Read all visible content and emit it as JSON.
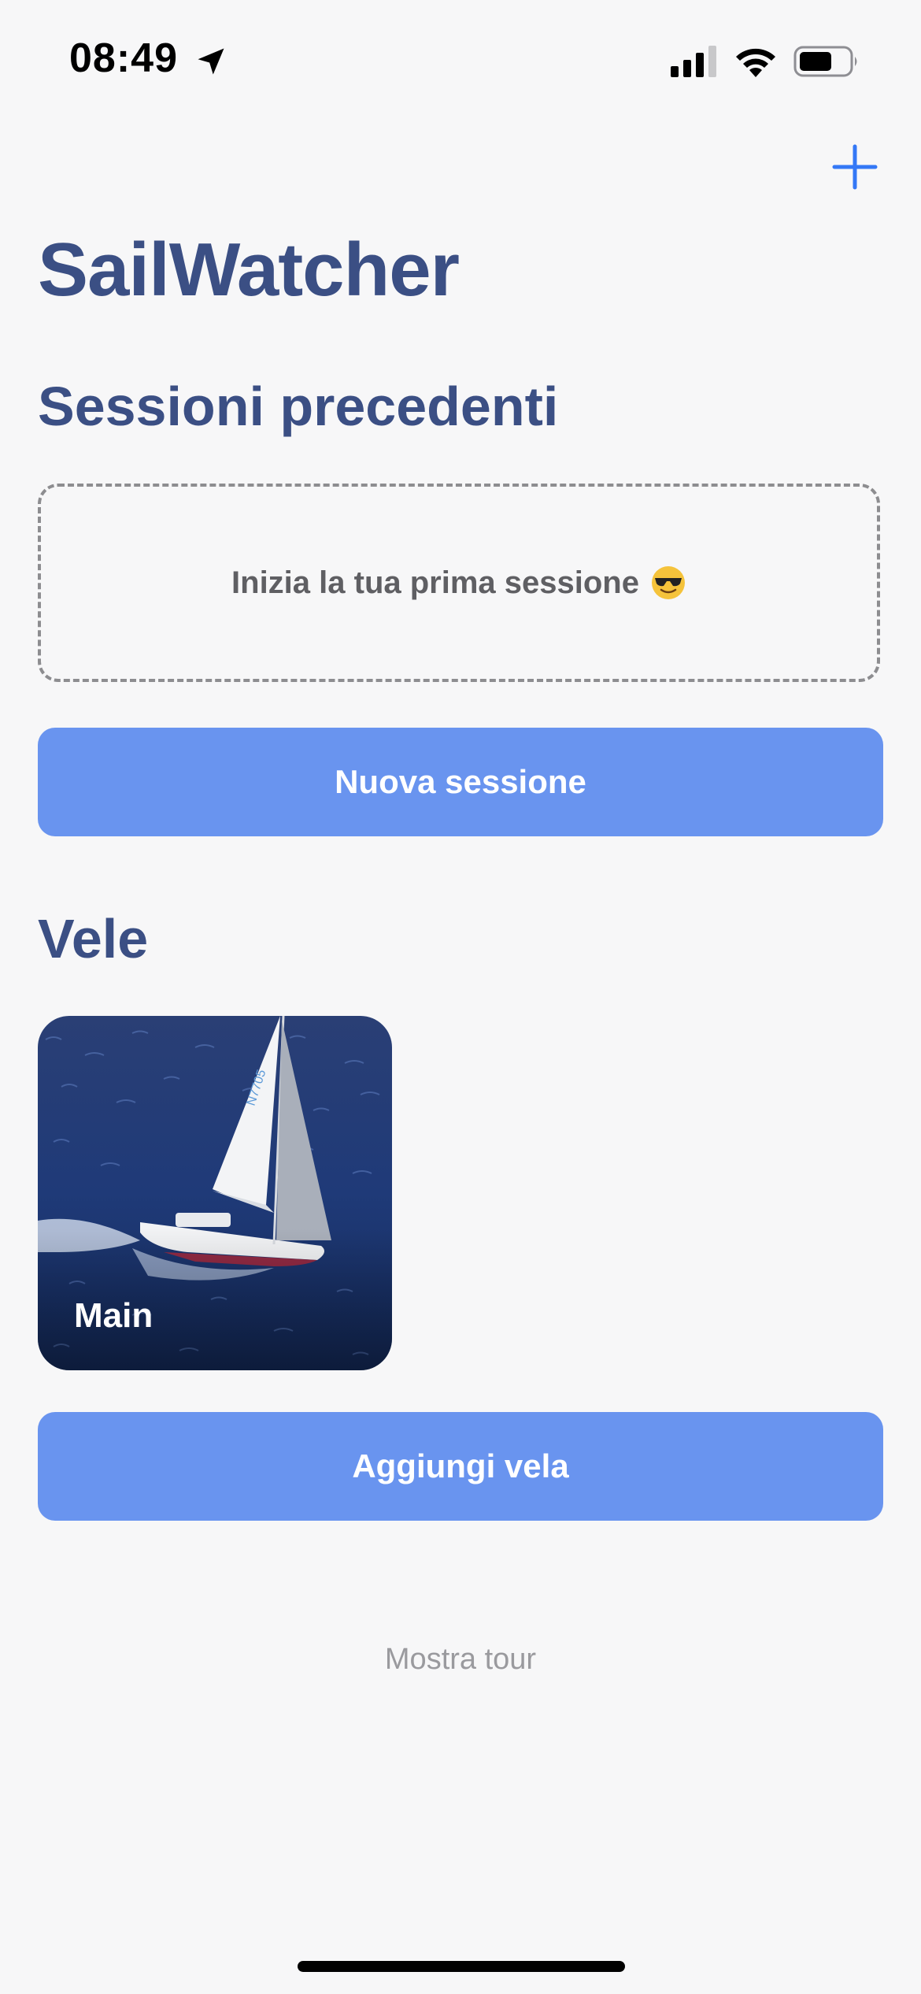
{
  "status_bar": {
    "time": "08:49",
    "icons": [
      "location-arrow-icon",
      "cellular-signal-icon",
      "wifi-icon",
      "battery-icon"
    ]
  },
  "nav": {
    "add_icon": "plus-icon"
  },
  "app_title": "SailWatcher",
  "sessions": {
    "title": "Sessioni precedenti",
    "empty_text": "Inizia la tua prima sessione",
    "empty_emoji": "sunglasses-face-icon",
    "new_session_label": "Nuova sessione"
  },
  "sails": {
    "title": "Vele",
    "items": [
      {
        "label": "Main",
        "image": "sailboat-photo"
      }
    ],
    "add_sail_label": "Aggiungi vela"
  },
  "footer": {
    "tour_label": "Mostra tour"
  },
  "colors": {
    "background": "#f7f7f8",
    "title": "#3b4f84",
    "button": "#6994ef",
    "accent": "#3478f6",
    "muted": "#9a9a9e"
  }
}
